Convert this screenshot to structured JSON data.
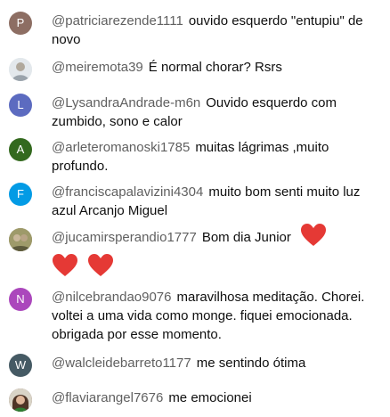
{
  "messages": [
    {
      "author": "@patriciarezende1111",
      "text": "ouvido esquerdo \"entupiu\" de novo",
      "avatar": {
        "letter": "P",
        "color": "#8d6e63",
        "type": "letter"
      }
    },
    {
      "author": "@meiremota39",
      "text": "É normal chorar? Rsrs",
      "avatar": {
        "letter": "",
        "color": "#cfd8dc",
        "type": "photo"
      }
    },
    {
      "author": "@LysandraAndrade-m6n",
      "text": "Ouvido esquerdo com zumbido, sono e calor",
      "avatar": {
        "letter": "L",
        "color": "#5c6bc0",
        "type": "letter"
      }
    },
    {
      "author": "@arleteromanoski1785",
      "text": "muitas lágrimas ,muito profundo.",
      "avatar": {
        "letter": "A",
        "color": "#33691e",
        "type": "letter"
      }
    },
    {
      "author": "@franciscapalavizini4304",
      "text": "muito bom senti muito luz azul Arcanjo Miguel",
      "avatar": {
        "letter": "F",
        "color": "#039be5",
        "type": "letter"
      }
    },
    {
      "author": "@jucamirsperandio1777",
      "text": "Bom dia Junior",
      "avatar": {
        "letter": "",
        "color": "#8d8a5e",
        "type": "photo"
      },
      "hearts": 3
    },
    {
      "author": "@nilcebrandao9076",
      "text": "maravilhosa meditação. Chorei. voltei a uma vida como monge. fiquei emocionada. obrigada por esse momento.",
      "avatar": {
        "letter": "N",
        "color": "#ab47bc",
        "type": "letter"
      }
    },
    {
      "author": "@walcleidebarreto1177",
      "text": "me sentindo ótima",
      "avatar": {
        "letter": "W",
        "color": "#455a64",
        "type": "letter"
      }
    },
    {
      "author": "@flaviarangel7676",
      "text": "me emocionei",
      "avatar": {
        "letter": "",
        "color": "#6d4c41",
        "type": "photo"
      }
    }
  ],
  "colors": {
    "author": "#606060",
    "text": "#0f0f0f",
    "heart": "#e53935"
  },
  "icons": {
    "heart": "red-heart-emoji"
  }
}
